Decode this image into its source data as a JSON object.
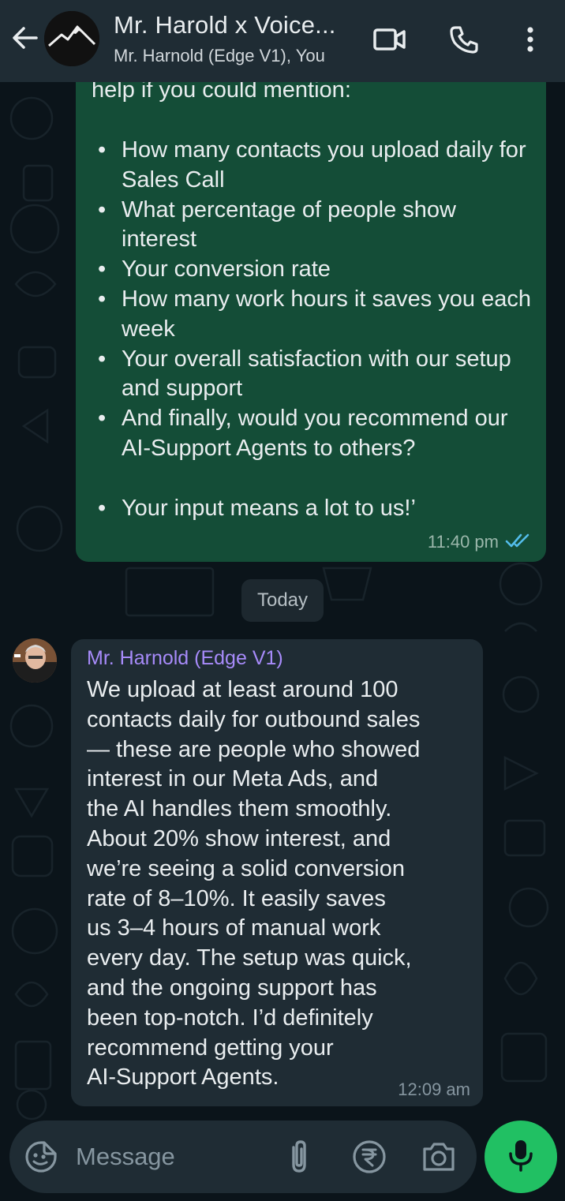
{
  "colors": {
    "header_bg": "#1f2c34",
    "chat_bg": "#0b141a",
    "outgoing_bubble": "#144d37",
    "incoming_bubble": "#1f2c34",
    "sender_name": "#a78bfa",
    "read_ticks": "#53bdeb",
    "mic_button": "#21c063"
  },
  "header": {
    "title": "Mr. Harold x Voice...",
    "subtitle": "Mr. Harnold (Edge V1), You",
    "icons": [
      "back-arrow-icon",
      "group-avatar-mountain",
      "video-call-icon",
      "voice-call-icon",
      "more-options-icon"
    ]
  },
  "outgoing_message": {
    "intro": "help if you could mention:",
    "bullets": [
      "How many contacts you upload daily for Sales Call",
      "What percentage of people show interest",
      "Your conversion rate",
      "How many work hours it saves you each week",
      "Your overall satisfaction with our setup and support",
      "And finally, would you recommend our AI-Support Agents to others?",
      "Your input means a lot to us!’"
    ],
    "time": "11:40 pm",
    "status": "read"
  },
  "date_separator": "Today",
  "incoming_message": {
    "sender": "Mr. Harnold (Edge V1)",
    "lines": [
      "We upload at least around 100",
      "contacts daily for outbound sales",
      "— these are people who showed",
      "interest in our Meta Ads, and",
      "the AI handles them smoothly.",
      "About 20% show interest, and",
      "we’re seeing a solid conversion",
      "rate of 8–10%. It easily saves",
      "us 3–4 hours of manual work",
      "every day. The setup was quick,",
      "and the ongoing support has",
      "been top-notch. I’d definitely",
      "recommend getting your",
      "AI-Support Agents."
    ],
    "time": "12:09 am"
  },
  "composer": {
    "placeholder": "Message",
    "value": "",
    "icons": [
      "sticker-emoji-icon",
      "attach-icon",
      "rupee-payment-icon",
      "camera-icon",
      "mic-icon"
    ]
  }
}
